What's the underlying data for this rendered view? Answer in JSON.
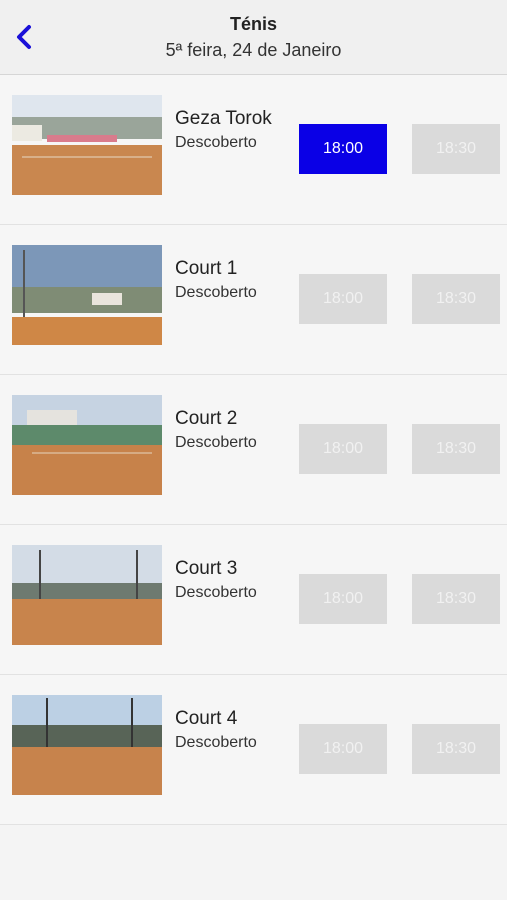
{
  "header": {
    "title": "Ténis",
    "date": "5ª feira, 24 de Janeiro",
    "back_icon": "chevron-left-icon",
    "accent_color": "#0a00e6"
  },
  "courts": [
    {
      "name": "Geza Torok",
      "surface": "Descoberto",
      "slots": [
        {
          "time": "18:00",
          "state": "selected"
        },
        {
          "time": "18:30",
          "state": "unavailable"
        }
      ]
    },
    {
      "name": "Court 1",
      "surface": "Descoberto",
      "slots": [
        {
          "time": "18:00",
          "state": "unavailable"
        },
        {
          "time": "18:30",
          "state": "unavailable"
        }
      ]
    },
    {
      "name": "Court 2",
      "surface": "Descoberto",
      "slots": [
        {
          "time": "18:00",
          "state": "unavailable"
        },
        {
          "time": "18:30",
          "state": "unavailable"
        }
      ]
    },
    {
      "name": "Court 3",
      "surface": "Descoberto",
      "slots": [
        {
          "time": "18:00",
          "state": "unavailable"
        },
        {
          "time": "18:30",
          "state": "unavailable"
        }
      ]
    },
    {
      "name": "Court 4",
      "surface": "Descoberto",
      "slots": [
        {
          "time": "18:00",
          "state": "unavailable"
        },
        {
          "time": "18:30",
          "state": "unavailable"
        }
      ]
    }
  ]
}
